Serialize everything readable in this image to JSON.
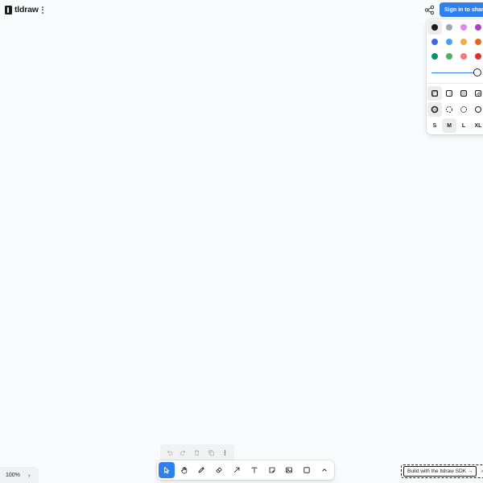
{
  "app": {
    "name": "tldraw"
  },
  "header": {
    "signin_label": "Sign in to share"
  },
  "style_panel": {
    "colors": [
      {
        "name": "black",
        "hex": "#1d1d1d",
        "selected": true
      },
      {
        "name": "grey",
        "hex": "#9fa8b2",
        "selected": false
      },
      {
        "name": "light-violet",
        "hex": "#e085f4",
        "selected": false
      },
      {
        "name": "violet",
        "hex": "#ae3ec9",
        "selected": false
      },
      {
        "name": "blue",
        "hex": "#4465e9",
        "selected": false
      },
      {
        "name": "light-blue",
        "hex": "#4ba1f1",
        "selected": false
      },
      {
        "name": "yellow",
        "hex": "#f1ac4b",
        "selected": false
      },
      {
        "name": "orange",
        "hex": "#e16919",
        "selected": false
      },
      {
        "name": "green",
        "hex": "#099268",
        "selected": false
      },
      {
        "name": "light-green",
        "hex": "#4cb05e",
        "selected": false
      },
      {
        "name": "light-red",
        "hex": "#f87777",
        "selected": false
      },
      {
        "name": "red",
        "hex": "#e03131",
        "selected": false
      }
    ],
    "opacity": 1,
    "fill_options": [
      "fill-none",
      "fill-semi",
      "fill-solid",
      "fill-pattern"
    ],
    "dash_options": [
      "dash-draw",
      "dash-dashed",
      "dash-dotted",
      "dash-solid"
    ],
    "sizes": [
      "S",
      "M",
      "L",
      "XL"
    ],
    "selected_size": "M"
  },
  "zoom": {
    "level": "100%"
  },
  "toolbar": {
    "tools": [
      "select",
      "hand",
      "draw",
      "eraser",
      "arrow",
      "text",
      "note",
      "image",
      "rectangle",
      "more"
    ],
    "selected": "select"
  },
  "sdk_badge": {
    "label": "Build with the tldraw SDK →",
    "close": "×"
  },
  "accent": "#2f80ed"
}
